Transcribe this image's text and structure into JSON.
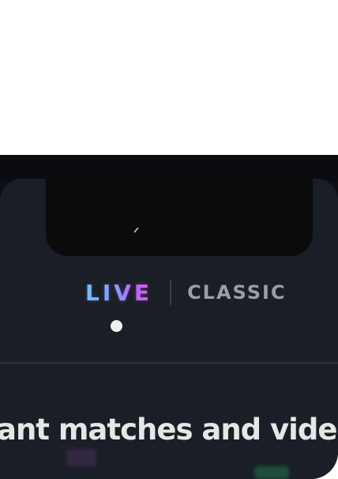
{
  "app": {
    "mode_switch": {
      "live_label": "LIVE",
      "classic_label": "CLASSIC",
      "selected": "LIVE"
    },
    "headline": "ant matches and vide",
    "colors": {
      "screen_bg": "#1a1e26",
      "notch": "#0b0b0c",
      "live_gradient_start": "#5bd6ff",
      "live_gradient_end": "#ff5ad0",
      "classic_text": "#9a9ea6",
      "indicator": "#f1f1f1"
    },
    "icons": [
      "status-mark-icon"
    ]
  }
}
